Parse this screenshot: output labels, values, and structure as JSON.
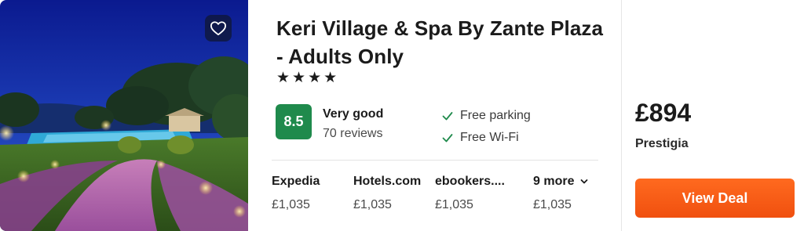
{
  "hotel": {
    "name": "Keri Village & Spa By Zante Plaza - Adults Only",
    "stars": "★★★★",
    "rating": {
      "score": "8.5",
      "label": "Very good",
      "reviews": "70 reviews",
      "badge_color": "#1f8a4c"
    },
    "amenities": [
      "Free parking",
      "Free Wi-Fi"
    ]
  },
  "offers": [
    {
      "provider": "Expedia",
      "price": "£1,035"
    },
    {
      "provider": "Hotels.com",
      "price": "£1,035"
    },
    {
      "provider": "ebookers....",
      "price": "£1,035"
    },
    {
      "provider": "9 more",
      "price": "£1,035"
    }
  ],
  "best_deal": {
    "price": "£894",
    "provider": "Prestigia",
    "button_label": "View Deal",
    "button_color": "#f35b15"
  },
  "icons": {
    "favorite": "heart-icon",
    "amenity": "check-icon",
    "more": "chevron-down-icon"
  }
}
